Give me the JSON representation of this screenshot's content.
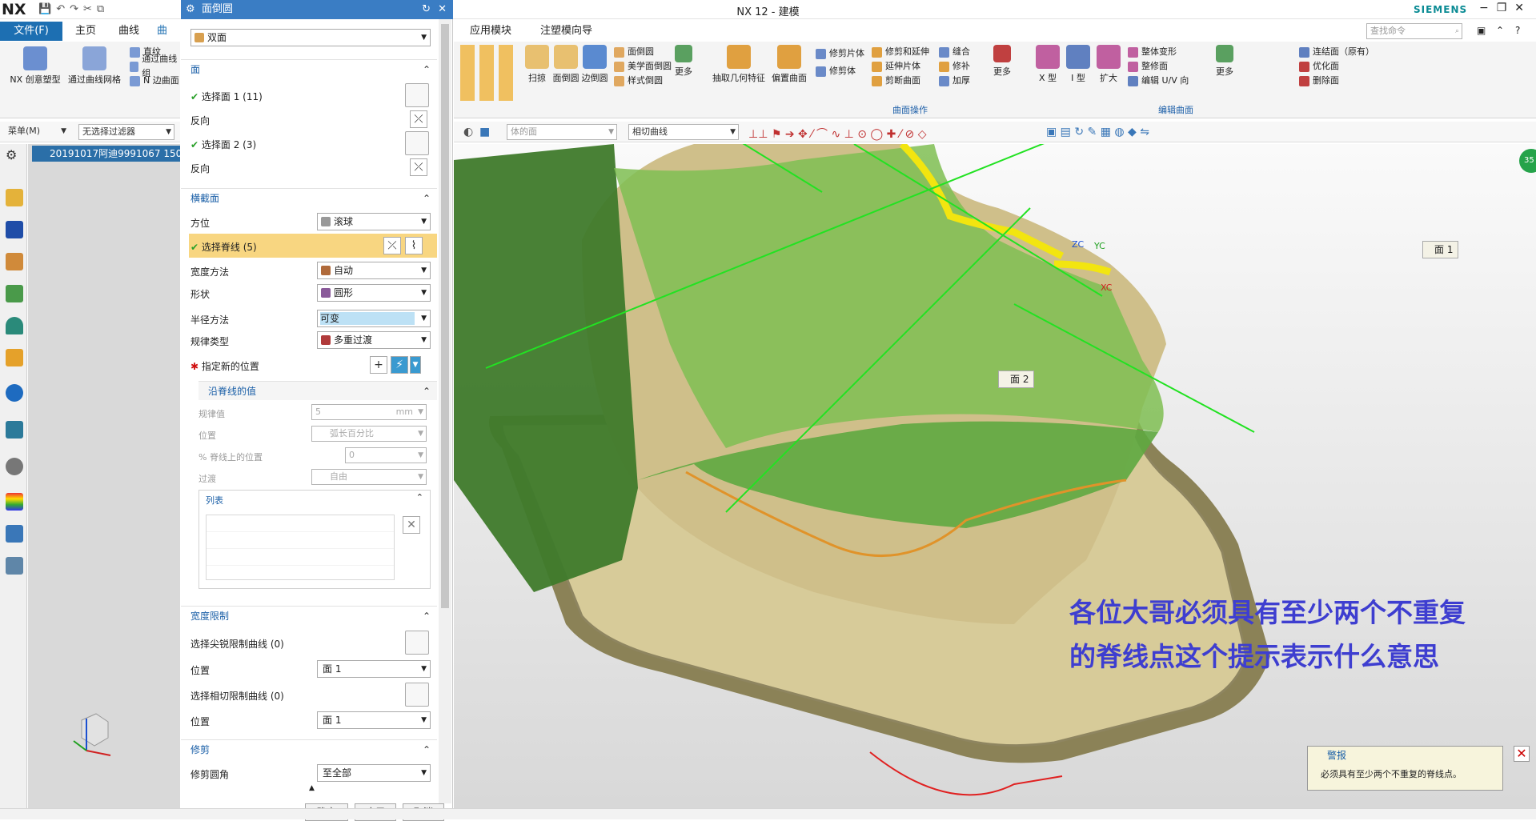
{
  "app": {
    "logo": "NX",
    "title": "NX 12 - 建模",
    "brand": "SIEMENS",
    "window_controls": [
      "−",
      "❐",
      "✕"
    ]
  },
  "menu_tabs": {
    "file": "文件(F)",
    "home": "主页",
    "curve": "曲线",
    "surface": "曲面",
    "app_modules": "应用模块",
    "annotation": "注塑模向导"
  },
  "ribbon_left": {
    "buttons": [
      "NX 创意塑型",
      "通过曲线网格"
    ],
    "small": [
      "直纹",
      "通过曲线组",
      "N 边曲面"
    ]
  },
  "filterbar": {
    "menu": "菜单(M)",
    "filter": "无选择过滤器"
  },
  "navigator": {
    "part": "20191017阿迪9991067 150"
  },
  "ribbon_main": {
    "group1_buttons": [
      "扫掠",
      "面倒圆",
      "边倒圆"
    ],
    "group1_small": [
      "面倒圆",
      "美学面倒圆",
      "样式倒圆"
    ],
    "more": "更多",
    "group2_buttons": [
      "抽取几何特征",
      "偏置曲面"
    ],
    "group2_small": [
      "修剪片体",
      "修剪体"
    ],
    "group2_small2": [
      "修剪和延伸",
      "延伸片体",
      "剪断曲面"
    ],
    "group2_small3": [
      "缝合",
      "修补",
      "加厚"
    ],
    "group2_label": "曲面操作",
    "group3_buttons": [
      "X 型",
      "I 型",
      "扩大"
    ],
    "group3_small": [
      "整体变形",
      "整修面",
      "编辑 U/V 向"
    ],
    "group3_label": "编辑曲面",
    "group4_small": [
      "连结面（原有）",
      "优化面",
      "删除面"
    ],
    "search_placeholder": "查找命令"
  },
  "toolbar2": {
    "filter1": "体的面",
    "filter2": "相切曲线"
  },
  "dialog": {
    "title": "面倒圆",
    "type": "双面",
    "sec_face": "面",
    "face1": "选择面 1 (11)",
    "reverse1": "反向",
    "face2": "选择面 2 (3)",
    "reverse2": "反向",
    "sec_cross": "横截面",
    "orient_label": "方位",
    "orient_value": "滚球",
    "spine": "选择脊线 (5)",
    "width_label": "宽度方法",
    "width_value": "自动",
    "shape_label": "形状",
    "shape_value": "圆形",
    "radius_label": "半径方法",
    "radius_value": "可变",
    "law_label": "规律类型",
    "law_value": "多重过渡",
    "new_loc": "指定新的位置",
    "sec_spine": "沿脊线的值",
    "law_val_label": "规律值",
    "law_val": "5",
    "law_unit": "mm",
    "pos_label": "位置",
    "pos_value": "弧长百分比",
    "pct_label": "% 脊线上的位置",
    "pct_value": "0",
    "trans_label": "过渡",
    "trans_value": "自由",
    "list_label": "列表",
    "sec_width": "宽度限制",
    "sharp_label": "选择尖锐限制曲线 (0)",
    "pos1_label": "位置",
    "pos1_value": "面 1",
    "tangent_label": "选择相切限制曲线 (0)",
    "pos2_label": "位置",
    "pos2_value": "面 1",
    "sec_trim": "修剪",
    "trim_label": "修剪圆角",
    "trim_value": "至全部",
    "ok": "< 确定 >",
    "apply": "应用",
    "cancel": "取消"
  },
  "viewport": {
    "face1_label": "面 1",
    "face2_label": "面 2",
    "axis": {
      "zc": "ZC",
      "yc": "YC",
      "xc": "XC"
    },
    "annotation_line1": "各位大哥必须具有至少两个不重复",
    "annotation_line2": "的脊线点这个提示表示什么意思",
    "tip_title": "警报",
    "tip_text": "必须具有至少两个不重复的脊线点。",
    "badge": "35"
  },
  "colors": {
    "accent": "#1d6fb2",
    "highlight": "#f8d681",
    "model_green": "#5faa3e",
    "model_tan": "#c2b582",
    "annotation": "#3e3ed0"
  }
}
